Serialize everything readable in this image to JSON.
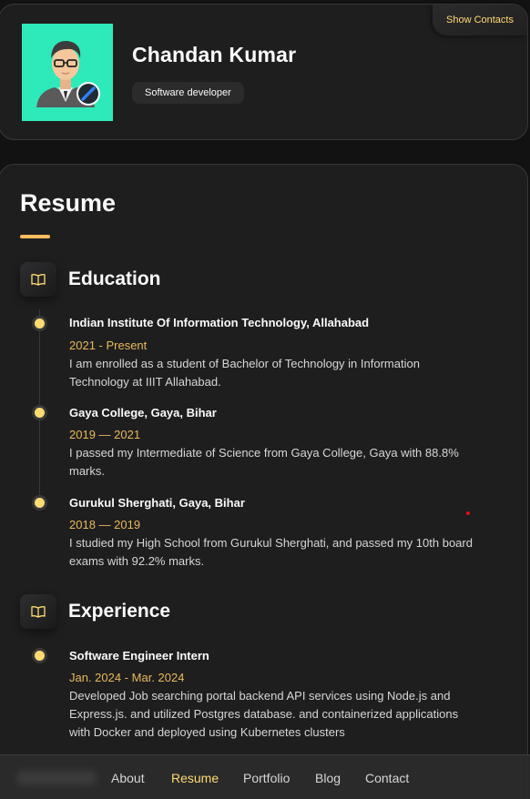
{
  "profile": {
    "name": "Chandan Kumar",
    "title": "Software developer",
    "show_contacts_label": "Show Contacts"
  },
  "page": {
    "title": "Resume"
  },
  "education": {
    "title": "Education",
    "icon": "book-icon",
    "items": [
      {
        "title": "Indian Institute Of Information Technology, Allahabad",
        "date": "2021 - Present",
        "text_lines": [
          "I am enrolled as a student of Bachelor of Technology in Information",
          "Technology at IIIT Allahabad."
        ]
      },
      {
        "title": "Gaya College, Gaya, Bihar",
        "date": "2019 — 2021",
        "text_lines": [
          "I passed my Intermediate of Science from Gaya College, Gaya with 88.8%",
          "marks."
        ]
      },
      {
        "title": "Gurukul Sherghati, Gaya, Bihar",
        "date": "2018 — 2019",
        "text_lines": [
          "I studied my High School from Gurukul Sherghati, and passed my 10th board",
          "exams with 92.2% marks."
        ]
      }
    ]
  },
  "experience": {
    "title": "Experience",
    "icon": "book-icon",
    "items": [
      {
        "title": "Software Engineer Intern",
        "date": "Jan. 2024 - Mar. 2024",
        "text_lines": [
          "Developed Job searching portal backend API services using Node.js and",
          "Express.js. and utilized Postgres database. and containerized applications",
          "with Docker and deployed using Kubernetes clusters"
        ]
      }
    ]
  },
  "nav": {
    "items": [
      {
        "label": "About"
      },
      {
        "label": "Resume"
      },
      {
        "label": "Portfolio"
      },
      {
        "label": "Blog"
      },
      {
        "label": "Contact"
      }
    ],
    "active": "Resume"
  },
  "colors": {
    "accent": "#ffdb70",
    "avatar_bg": "#2ee9b9",
    "card_bg": "#1e1e1f"
  }
}
